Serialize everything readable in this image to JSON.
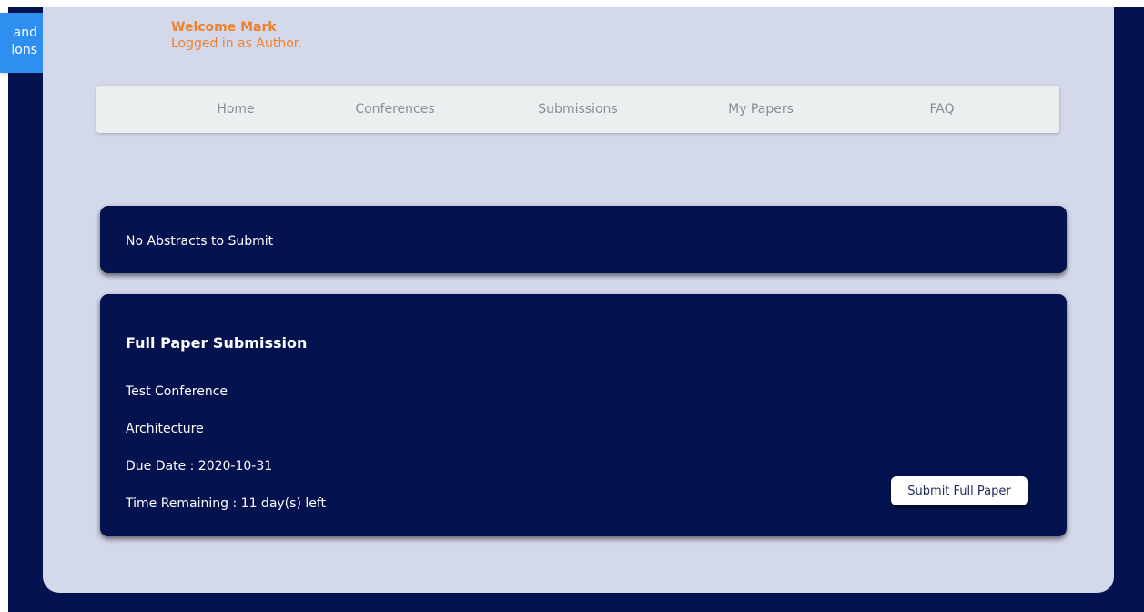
{
  "side_tab": {
    "line1": "and",
    "line2": "ions"
  },
  "header": {
    "welcome": "Welcome Mark",
    "role": "Logged in as Author."
  },
  "nav": {
    "items": [
      {
        "label": "Home"
      },
      {
        "label": "Conferences"
      },
      {
        "label": "Submissions"
      },
      {
        "label": "My Papers"
      },
      {
        "label": "FAQ"
      }
    ]
  },
  "abstracts": {
    "message": "No Abstracts to Submit"
  },
  "full_paper": {
    "title": "Full Paper Submission",
    "conference": "Test Conference",
    "track": "Architecture",
    "due_date": "Due Date : 2020-10-31",
    "time_remaining": "Time Remaining : 11 day(s) left",
    "submit_label": "Submit Full Paper"
  },
  "colors": {
    "navy": "#04124f",
    "panel": "#d4d8eb",
    "accent_orange": "#f0812a",
    "side_tab_blue": "#2e8ff0"
  }
}
